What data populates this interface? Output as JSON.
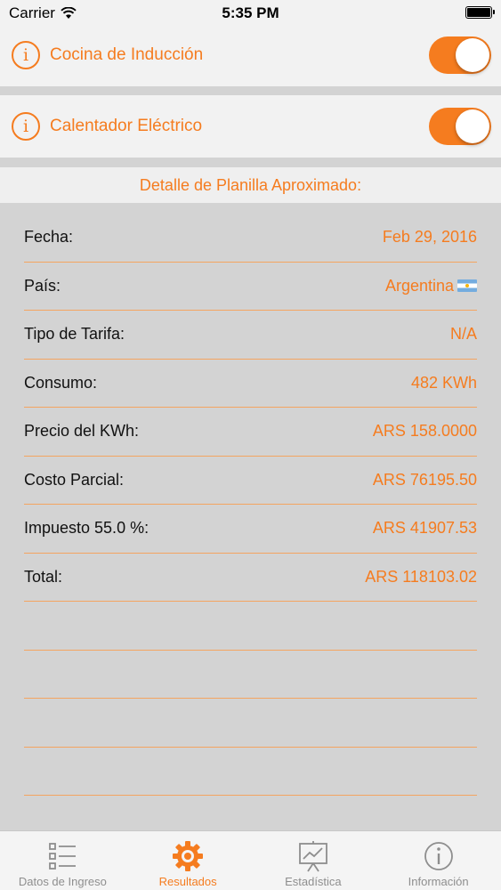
{
  "status_bar": {
    "carrier": "Carrier",
    "time": "5:35 PM"
  },
  "toggles": [
    {
      "label": "Cocina de Inducción",
      "on": true
    },
    {
      "label": "Calentador Eléctrico",
      "on": true
    }
  ],
  "section_title": "Detalle de Planilla Aproximado:",
  "details": [
    {
      "key": "Fecha:",
      "value": "Feb 29, 2016"
    },
    {
      "key": "País:",
      "value": "Argentina"
    },
    {
      "key": "Tipo de Tarifa:",
      "value": "N/A"
    },
    {
      "key": "Consumo:",
      "value": "482 KWh"
    },
    {
      "key": "Precio del KWh:",
      "value": "ARS 158.0000"
    },
    {
      "key": "Costo Parcial:",
      "value": "ARS 76195.50"
    },
    {
      "key": "Impuesto 55.0 %:",
      "value": "ARS 41907.53"
    },
    {
      "key": "Total:",
      "value": "ARS 118103.02"
    }
  ],
  "tabs": [
    {
      "label": "Datos de Ingreso",
      "icon": "list-icon",
      "active": false
    },
    {
      "label": "Resultados",
      "icon": "gear-icon",
      "active": true
    },
    {
      "label": "Estadística",
      "icon": "chart-board-icon",
      "active": false
    },
    {
      "label": "Información",
      "icon": "info-icon",
      "active": false
    }
  ],
  "colors": {
    "accent": "#f57c1f",
    "background": "#d3d3d3",
    "row_background": "#f2f2f2"
  }
}
